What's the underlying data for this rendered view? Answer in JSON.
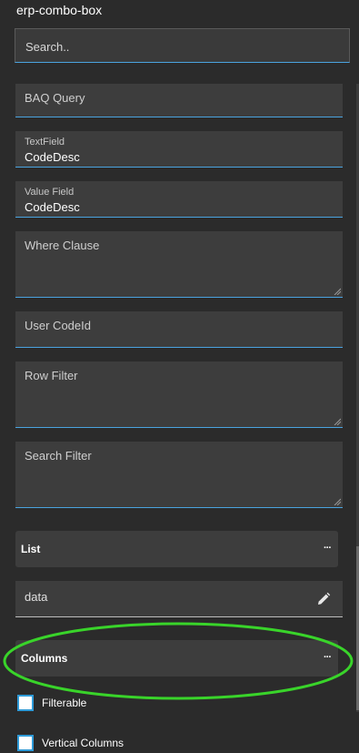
{
  "panel": {
    "title": "erp-combo-box"
  },
  "search": {
    "placeholder": "Search.."
  },
  "fields": {
    "baq_query": {
      "label": "BAQ Query"
    },
    "text_field": {
      "label": "TextField",
      "value": "CodeDesc"
    },
    "value_field": {
      "label": "Value Field",
      "value": "CodeDesc"
    },
    "where_clause": {
      "label": "Where Clause"
    },
    "user_code_id": {
      "label": "User CodeId"
    },
    "row_filter": {
      "label": "Row Filter"
    },
    "search_filter": {
      "label": "Search Filter"
    }
  },
  "list_group": {
    "label": "List",
    "more": "···"
  },
  "data_field": {
    "value": "data"
  },
  "columns_group": {
    "label": "Columns",
    "more": "···"
  },
  "checkboxes": {
    "filterable": {
      "label": "Filterable",
      "checked": false
    },
    "vertical_columns": {
      "label": "Vertical Columns",
      "checked": false
    }
  },
  "colors": {
    "accent": "#4aa3df",
    "highlight": "#39d42a",
    "background": "#2b2b2b",
    "field_bg": "#3d3d3d"
  },
  "icons": {
    "edit": "pencil-icon",
    "more": "ellipsis-icon"
  }
}
